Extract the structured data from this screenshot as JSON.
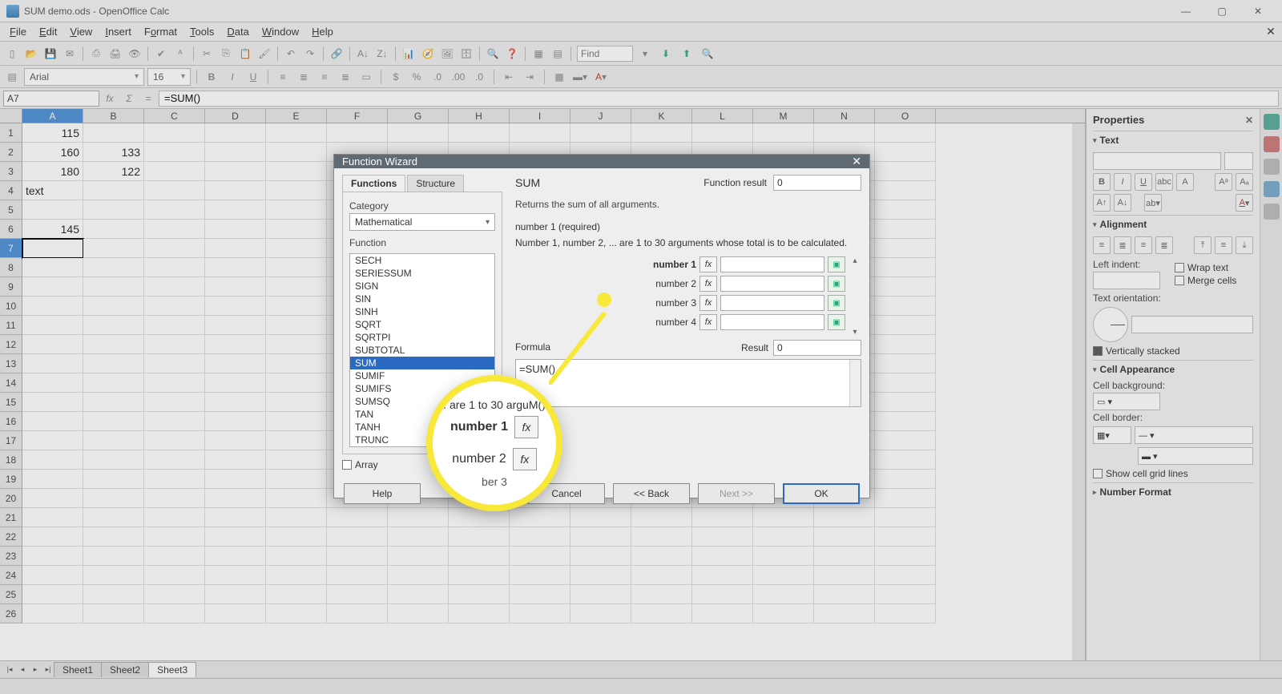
{
  "window": {
    "title": "SUM demo.ods - OpenOffice Calc"
  },
  "menu": [
    "File",
    "Edit",
    "View",
    "Insert",
    "Format",
    "Tools",
    "Data",
    "Window",
    "Help"
  ],
  "find": {
    "placeholder": "Find"
  },
  "fontrow": {
    "font": "Arial",
    "size": "16"
  },
  "namebox": "A7",
  "formula_input": "=SUM()",
  "columns": [
    "A",
    "B",
    "C",
    "D",
    "E",
    "F",
    "G",
    "H",
    "I",
    "J",
    "K",
    "L",
    "M",
    "N",
    "O"
  ],
  "rows": 26,
  "cells": {
    "A1": "115",
    "A2": "160",
    "B2": "133",
    "A3": "180",
    "B3": "122",
    "A4": "text",
    "A6": "145"
  },
  "active_cell": "A7",
  "sheets": [
    "Sheet1",
    "Sheet2",
    "Sheet3"
  ],
  "active_sheet": 2,
  "sidebar": {
    "title": "Properties",
    "text_section": "Text",
    "align_section": "Alignment",
    "left_indent": "Left indent:",
    "wrap": "Wrap text",
    "merge": "Merge cells",
    "orient": "Text orientation:",
    "vstacked": "Vertically stacked",
    "cellapp_section": "Cell Appearance",
    "cellbg": "Cell background:",
    "cellborder": "Cell border:",
    "gridlines": "Show cell grid lines",
    "numfmt_section": "Number Format"
  },
  "dialog": {
    "title": "Function Wizard",
    "tabs": [
      "Functions",
      "Structure"
    ],
    "category_label": "Category",
    "category": "Mathematical",
    "function_label": "Function",
    "functions": [
      "SECH",
      "SERIESSUM",
      "SIGN",
      "SIN",
      "SINH",
      "SQRT",
      "SQRTPI",
      "SUBTOTAL",
      "SUM",
      "SUMIF",
      "SUMIFS",
      "SUMSQ",
      "TAN",
      "TANH",
      "TRUNC"
    ],
    "sel_fn": "SUM",
    "array_label": "Array",
    "fn_name": "SUM",
    "fn_result_label": "Function result",
    "fn_result": "0",
    "description": "Returns the sum of all arguments.",
    "arg1_label": "number 1 (required)",
    "arg_desc": "Number 1, number 2, ... are 1 to 30 arguments whose total is to be calculated.",
    "args": [
      "number 1",
      "number 2",
      "number 3",
      "number 4"
    ],
    "formula_label": "Formula",
    "result_label": "Result",
    "result": "0",
    "formula_text": "=SUM()",
    "buttons": {
      "help": "Help",
      "cancel": "Cancel",
      "back": "<< Back",
      "next": "Next >>",
      "ok": "OK"
    }
  },
  "callout": {
    "top_text": ". are 1 to 30 arguM()",
    "r1": "number 1",
    "r2": "number 2",
    "r3": "ber 3",
    "fx": "fx"
  }
}
